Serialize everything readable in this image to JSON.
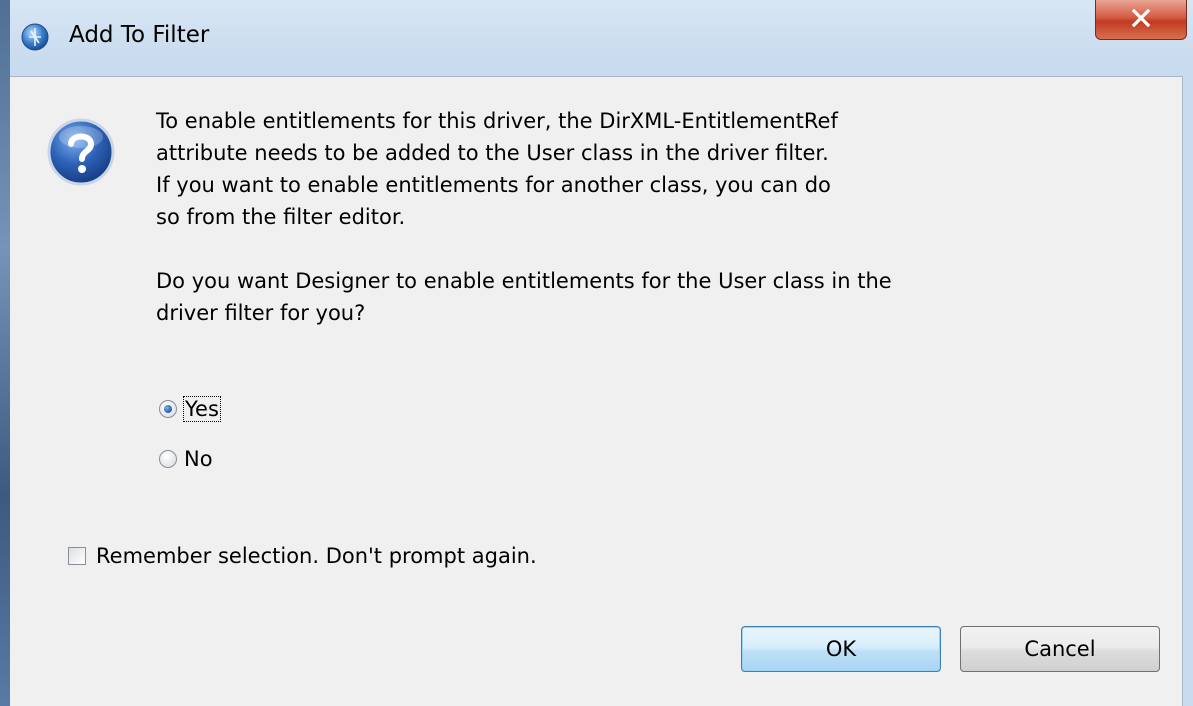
{
  "window": {
    "title": "Add To Filter",
    "close_glyph": "X"
  },
  "icons": {
    "title": "app-globe-icon",
    "question": "question-icon"
  },
  "message": {
    "paragraph1": [
      "To enable entitlements for this driver, the DirXML-EntitlementRef",
      "attribute needs to be added to the User class in the driver filter.",
      "If you want to enable entitlements for another class, you can do",
      "so from the filter editor."
    ],
    "paragraph2": [
      "Do you want Designer to enable entitlements for the User class in the",
      "driver filter for you?"
    ]
  },
  "options": {
    "yes_label": "Yes",
    "no_label": "No",
    "selected": "Yes"
  },
  "remember": {
    "label": "Remember selection. Don't prompt again.",
    "checked": false
  },
  "buttons": {
    "ok_label": "OK",
    "cancel_label": "Cancel"
  },
  "colors": {
    "client_bg": "#f0f0f0",
    "frame": "#c9dbee",
    "close_button": "#c23b21",
    "default_button_border": "#3c7fb1"
  }
}
